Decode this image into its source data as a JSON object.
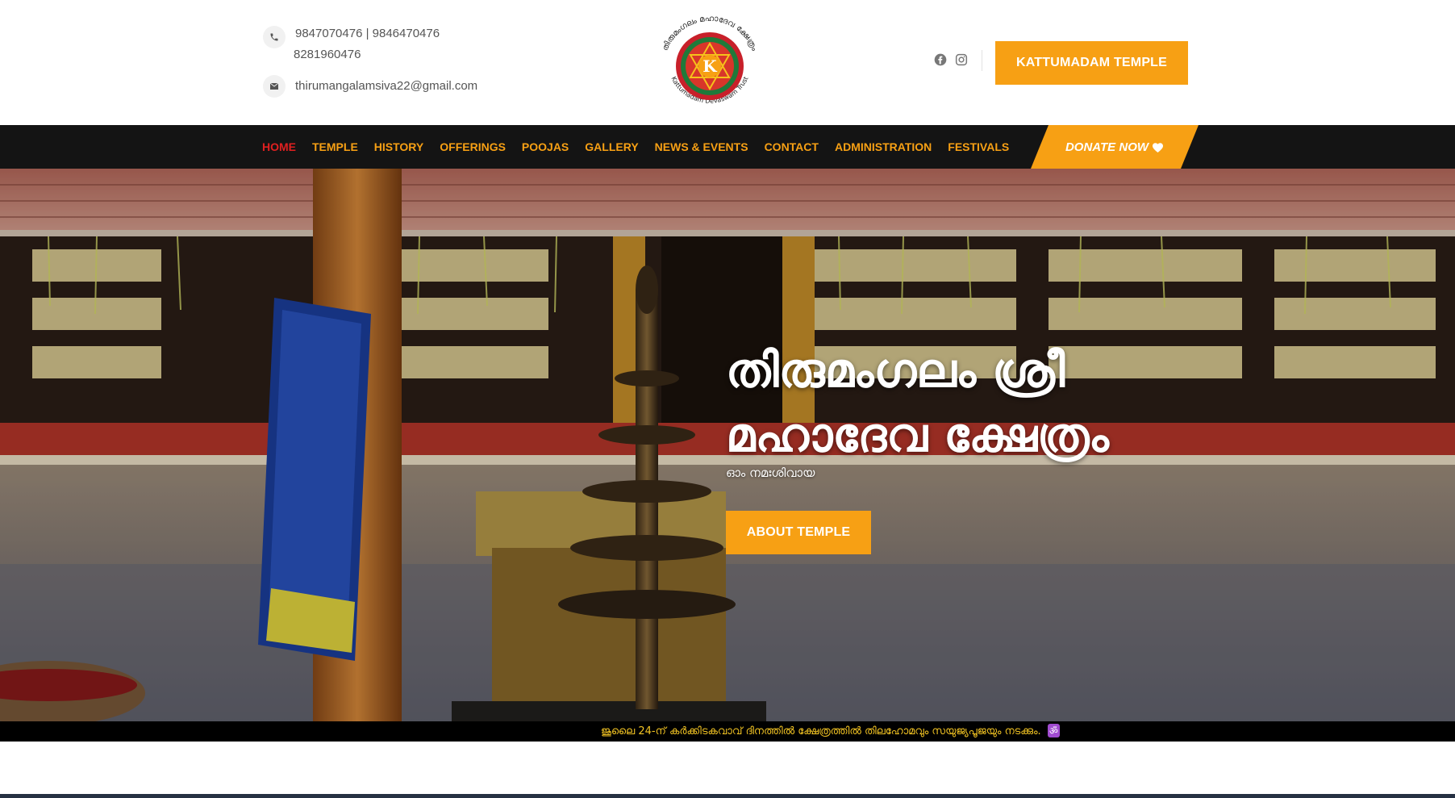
{
  "header": {
    "phone_line1": "9847070476 | 9846470476",
    "phone_line2": "8281960476",
    "email": "thirumangalamsiva22@gmail.com",
    "logo": {
      "ring_text_top": "തിരുമംഗലം മഹാദേവ ക്ഷേത്രം",
      "ring_text_bottom": "Kattumadam Devaswam Trust",
      "center_letter": "K"
    },
    "social_icons": [
      "facebook-icon",
      "instagram-icon"
    ],
    "cta_label": "KATTUMADAM TEMPLE"
  },
  "nav": {
    "items": [
      {
        "label": "HOME",
        "active": true
      },
      {
        "label": "TEMPLE",
        "active": false
      },
      {
        "label": "HISTORY",
        "active": false
      },
      {
        "label": "OFFERINGS",
        "active": false
      },
      {
        "label": "POOJAS",
        "active": false
      },
      {
        "label": "GALLERY",
        "active": false
      },
      {
        "label": "NEWS & EVENTS",
        "active": false
      },
      {
        "label": "CONTACT",
        "active": false
      },
      {
        "label": "ADMINISTRATION",
        "active": false
      },
      {
        "label": "FESTIVALS",
        "active": false
      }
    ],
    "donate_label": "DONATE NOW",
    "donate_icon": "heart-icon"
  },
  "hero": {
    "title_line1": "തിരുമംഗലം ശ്രീ",
    "title_line2": "മഹാദേവ ക്ഷേത്രം",
    "subtitle": "ഓം നമഃശിവായ",
    "button_label": "ABOUT TEMPLE"
  },
  "ticker": {
    "text": "ജൂലൈ 24-ന് കർക്കിടകവാവ് ദിനത്തിൽ ക്ഷേത്രത്തിൽ തിലഹോമവും സയുജ്യപൂജയും നടക്കും.",
    "emoji": "ॐ"
  },
  "colors": {
    "accent": "#f7a014",
    "nav_bg": "#141414",
    "active_nav": "#e02020",
    "ticker_text": "#f3c423"
  }
}
